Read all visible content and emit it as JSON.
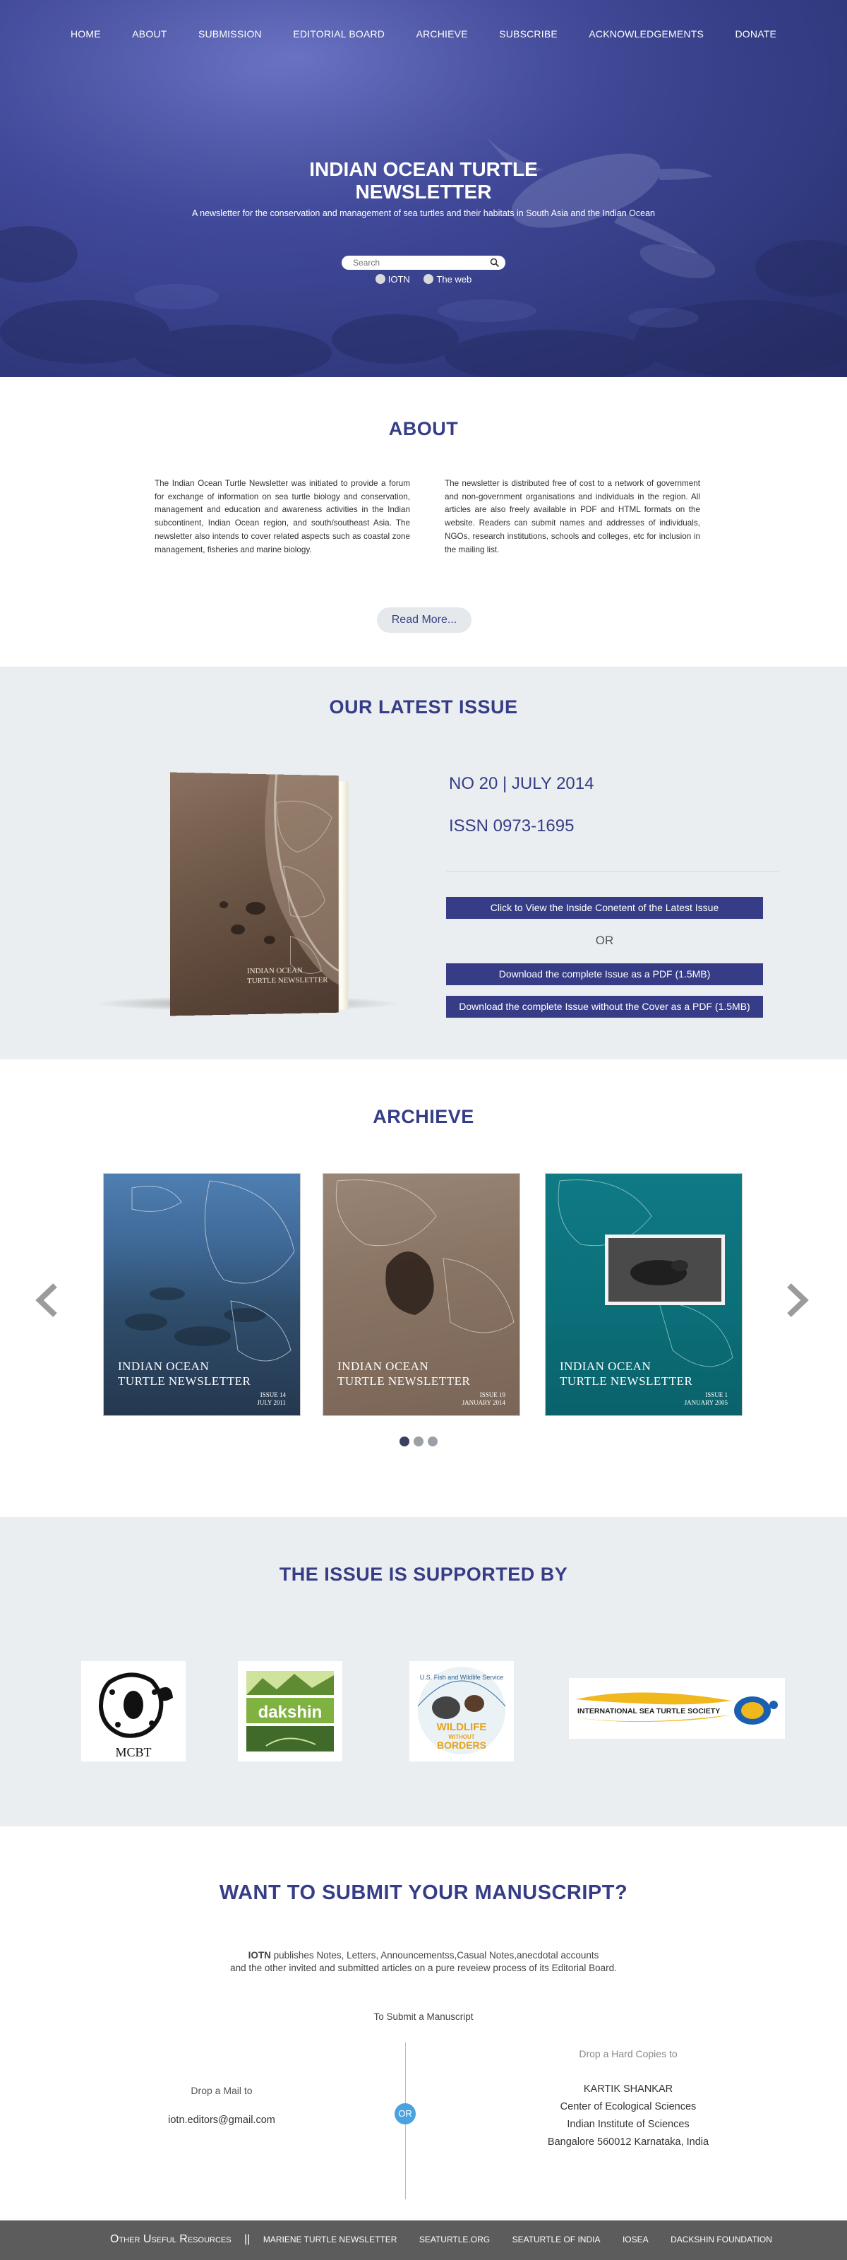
{
  "nav": [
    {
      "label": "HOME"
    },
    {
      "label": "ABOUT"
    },
    {
      "label": "SUBMISSION"
    },
    {
      "label": "EDITORIAL BOARD"
    },
    {
      "label": "ARCHIEVE"
    },
    {
      "label": "SUBSCRIBE"
    },
    {
      "label": "ACKNOWLEDGEMENTS"
    },
    {
      "label": "DONATE"
    }
  ],
  "hero": {
    "title_line1": "INDIAN OCEAN TURTLE",
    "title_line2": "NEWSLETTER",
    "subtitle": "A newsletter for the conservation and management of sea turtles and their habitats in South Asia and the Indian Ocean",
    "search_placeholder": "Search",
    "radio_iotn": "IOTN",
    "radio_web": "The web"
  },
  "about": {
    "title": "ABOUT",
    "col1": "The Indian Ocean Turtle Newsletter was initiated to provide a forum for exchange of information on sea turtle biology and conservation, management and education and awareness activities in the Indian subcontinent, Indian Ocean region, and south/southeast Asia. The newsletter also intends to cover related aspects such as coastal zone management, fisheries and marine biology.",
    "col2": "The newsletter is distributed free of cost to a network of government and non-government organisations and individuals in the region. All articles are also freely available in PDF and HTML formats on the website. Readers can submit names and addresses of individuals, NGOs, research institutions, schools and colleges, etc for inclusion in the mailing list.",
    "read_more": "Read More..."
  },
  "latest": {
    "title": "OUR LATEST ISSUE",
    "issue": "NO 20 | JULY 2014",
    "issn": "ISSN 0973-1695",
    "btn_inside": "Click to View the Inside Conetent of the Latest Issue",
    "or": "OR",
    "btn_pdf": "Download the complete Issue as a PDF (1.5MB)",
    "btn_pdf_nocover": "Download the complete Issue without the Cover as a PDF (1.5MB)"
  },
  "archive": {
    "title": "ARCHIEVE",
    "cards": [
      {
        "title_line1": "INDIAN OCEAN",
        "title_line2": "TURTLE NEWSLETTER",
        "issue": "ISSUE 14",
        "date": "JULY 2011"
      },
      {
        "title_line1": "INDIAN OCEAN",
        "title_line2": "TURTLE NEWSLETTER",
        "issue": "ISSUE 19",
        "date": "JANUARY 2014"
      },
      {
        "title_line1": "INDIAN OCEAN",
        "title_line2": "TURTLE NEWSLETTER",
        "issue": "ISSUE 1",
        "date": "JANUARY 2005"
      }
    ],
    "active_dot": 1
  },
  "supported": {
    "title": "THE ISSUE IS SUPPORTED BY",
    "logos": [
      {
        "text": "MCBT"
      },
      {
        "text": "dakshin"
      },
      {
        "text_top": "U.S. Fish and Wildlife Service",
        "text_main1": "WILDLIFE",
        "text_main2": "WITHOUT",
        "text_main3": "BORDERS"
      },
      {
        "text": "INTERNATIONAL SEA TURTLE SOCIETY"
      }
    ]
  },
  "submit": {
    "title": "WANT TO SUBMIT YOUR MANUSCRIPT?",
    "desc_bold": "IOTN",
    "desc_line1": " publishes Notes, Letters, Announcementss,Casual Notes,anecdotal accounts",
    "desc_line2": "and  the other invited and submitted articles on a pure reveiew process of its Editorial Board.",
    "to_submit": "To Submit a Manuscript",
    "drop_mail": "Drop a Mail to",
    "email": "iotn.editors@gmail.com",
    "or": "OR",
    "drop_hard": "Drop a Hard Copies to",
    "address": [
      "KARTIK SHANKAR",
      "Center of Ecological Sciences",
      "Indian Institute of Sciences",
      "Bangalore 560012  Karnataka, India"
    ]
  },
  "footer": {
    "lead": "Other Useful Resources",
    "sep": "||",
    "links": [
      "MARIENE TURTLE NEWSLETTER",
      "SEATURTLE.ORG",
      "SEATURTLE OF INDIA",
      "IOSEA",
      "DACKSHIN FOUNDATION"
    ]
  },
  "colors": {
    "accent": "#363d86",
    "section_bg": "#ebeef0",
    "footer_bg": "#5c5c5c",
    "or_circle": "#4aa3e0"
  }
}
